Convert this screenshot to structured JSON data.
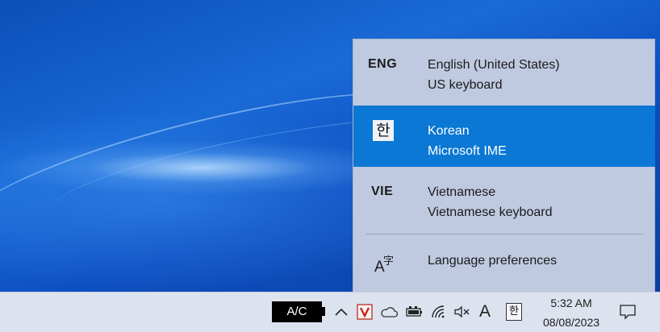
{
  "languages": [
    {
      "abbr": "ENG",
      "name": "English (United States)",
      "layout": "US keyboard",
      "selected": false
    },
    {
      "abbr": "한",
      "name": "Korean",
      "layout": "Microsoft IME",
      "selected": true
    },
    {
      "abbr": "VIE",
      "name": "Vietnamese",
      "layout": "Vietnamese keyboard",
      "selected": false
    }
  ],
  "preferences": {
    "label": "Language preferences",
    "icon_big": "A",
    "icon_small": "字"
  },
  "taskbar": {
    "battery_label": "A/C",
    "tray_icons": [
      "chevron-up-icon",
      "antivirus-icon",
      "onedrive-icon",
      "battery-icon",
      "wifi-icon",
      "volume-muted-icon",
      "input-mode-icon",
      "ime-icon"
    ],
    "input_mode": "A",
    "ime_label": "한",
    "time": "5:32 AM",
    "date": "08/08/2023"
  },
  "colors": {
    "selected": "#0a78d4",
    "flyout_bg": "#bfc9e0",
    "taskbar_bg": "#dde3ee"
  }
}
